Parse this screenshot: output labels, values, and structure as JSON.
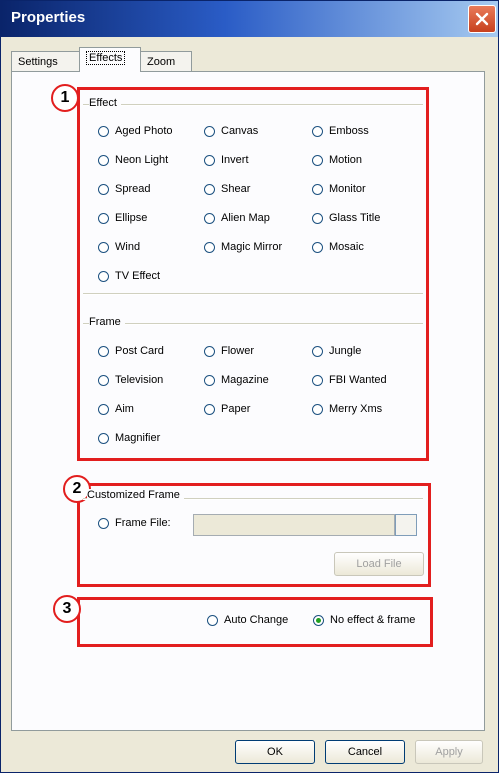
{
  "window": {
    "title": "Properties"
  },
  "tabs": [
    {
      "label": "Settings",
      "active": false
    },
    {
      "label": "Effects",
      "active": true
    },
    {
      "label": "Zoom",
      "active": false
    }
  ],
  "callouts": [
    "1",
    "2",
    "3"
  ],
  "effect_group": {
    "label": "Effect",
    "options": [
      "Aged Photo",
      "Canvas",
      "Emboss",
      "Neon Light",
      "Invert",
      "Motion",
      "Spread",
      "Shear",
      "Monitor",
      "Ellipse",
      "Alien Map",
      "Glass Title",
      "Wind",
      "Magic Mirror",
      "Mosaic",
      "TV Effect"
    ]
  },
  "frame_group": {
    "label": "Frame",
    "options": [
      "Post Card",
      "Flower",
      "Jungle",
      "Television",
      "Magazine",
      "FBI Wanted",
      "Aim",
      "Paper",
      "Merry Xms",
      "Magnifier"
    ]
  },
  "custom_frame": {
    "label": "Customized Frame",
    "frame_file_label": "Frame File:",
    "frame_file_value": "",
    "load_button": "Load File"
  },
  "mode": {
    "auto_change": "Auto Change",
    "no_effect": "No effect & frame",
    "selected": "no_effect"
  },
  "footer": {
    "ok": "OK",
    "cancel": "Cancel",
    "apply": "Apply"
  },
  "colors": {
    "annotation": "#e21e1e",
    "titlebar": "#0a246a",
    "dialog": "#ece9d8"
  }
}
